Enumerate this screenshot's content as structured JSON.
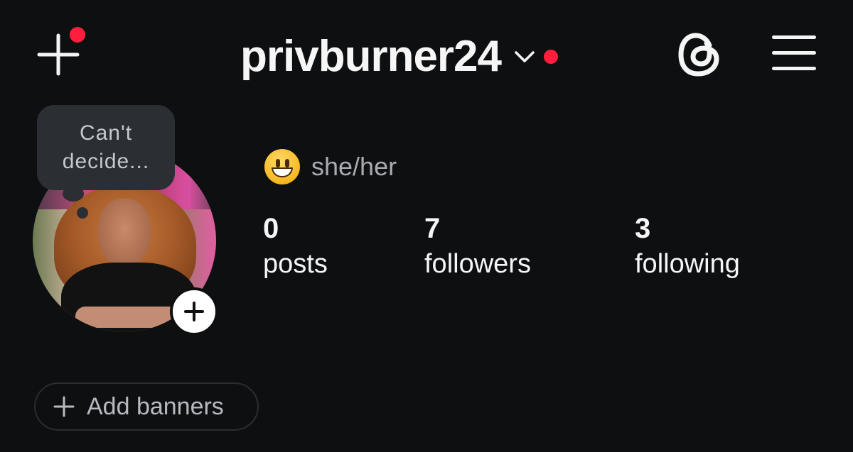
{
  "header": {
    "username": "privburner24",
    "icons": {
      "new_post": "plus-icon",
      "switcher": "chevron-down-icon",
      "threads": "threads-icon",
      "menu": "hamburger-menu-icon"
    }
  },
  "profile": {
    "note": "Can't decide...",
    "pronouns": "she/her",
    "emoji": "grinning-face-emoji"
  },
  "stats": {
    "posts": {
      "count": "0",
      "label": "posts"
    },
    "followers": {
      "count": "7",
      "label": "followers"
    },
    "following": {
      "count": "3",
      "label": "following"
    }
  },
  "actions": {
    "add_banners": "Add banners"
  },
  "colors": {
    "background": "#0d0f11",
    "notification_dot": "#ff1f3d",
    "note_bubble": "#2b2e33",
    "secondary_text": "#a8abb0"
  }
}
